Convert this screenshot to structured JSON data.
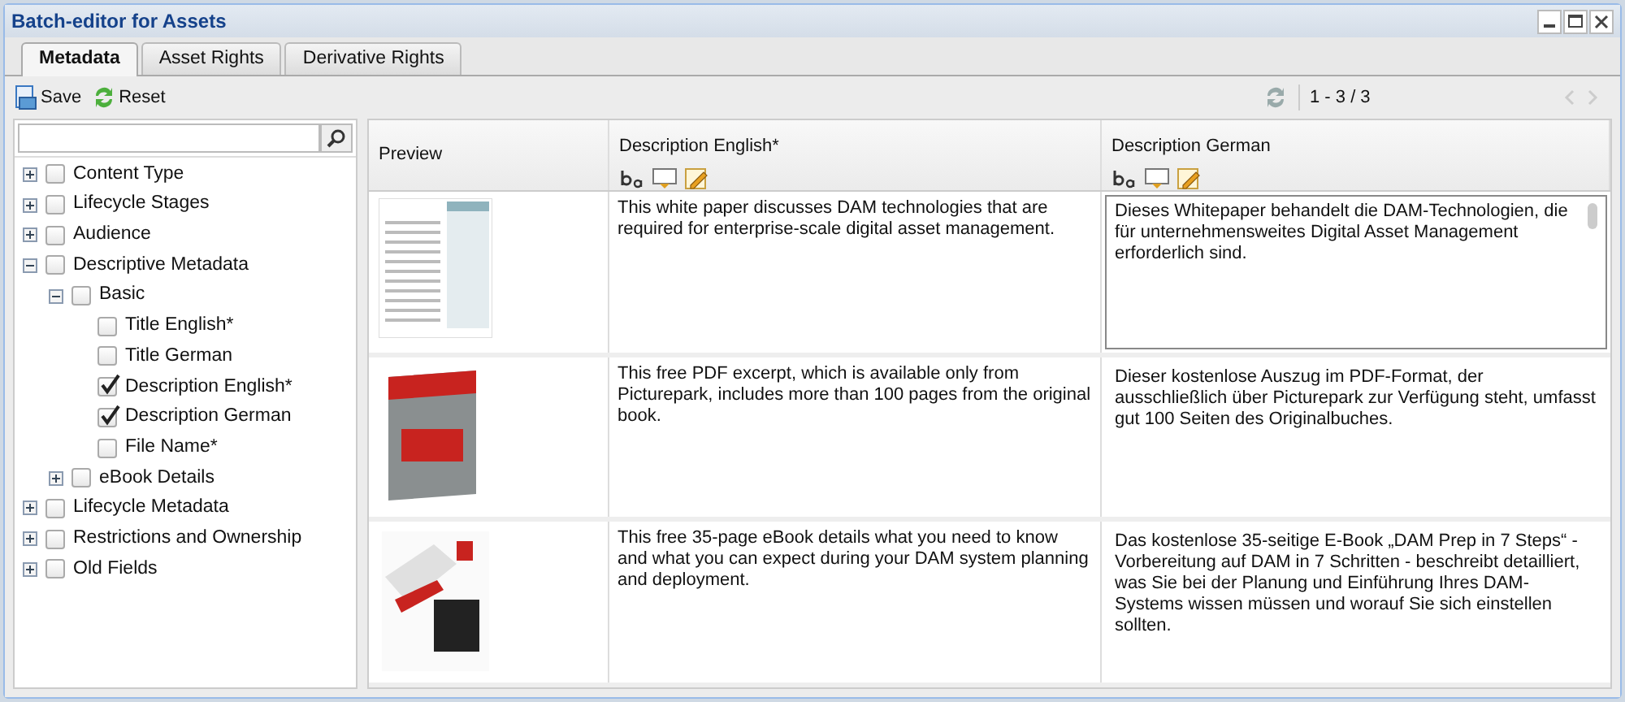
{
  "window": {
    "title": "Batch-editor for Assets"
  },
  "tabs": [
    {
      "label": "Metadata",
      "selected": true
    },
    {
      "label": "Asset Rights",
      "selected": false
    },
    {
      "label": "Derivative Rights",
      "selected": false
    }
  ],
  "toolbar": {
    "buttons": [
      {
        "kind": "save",
        "label": "Save"
      },
      {
        "kind": "reset",
        "label": "Reset"
      }
    ],
    "pager": "1 - 3 / 3"
  },
  "tree": [
    {
      "label": "Content Type",
      "expanded": false,
      "checked": false
    },
    {
      "label": "Lifecycle Stages",
      "expanded": false,
      "checked": false
    },
    {
      "label": "Audience",
      "expanded": false,
      "checked": false
    },
    {
      "label": "Descriptive Metadata",
      "expanded": true,
      "checked": false,
      "children": [
        {
          "label": "Basic",
          "expanded": true,
          "checked": false,
          "children": [
            {
              "label": "Title English*",
              "checked": false
            },
            {
              "label": "Title German",
              "checked": false
            },
            {
              "label": "Description English*",
              "checked": true
            },
            {
              "label": "Description German",
              "checked": true
            },
            {
              "label": "File Name*",
              "checked": false
            }
          ]
        },
        {
          "label": "eBook Details",
          "expanded": false,
          "checked": false
        }
      ]
    },
    {
      "label": "Lifecycle Metadata",
      "expanded": false,
      "checked": false
    },
    {
      "label": "Restrictions and Ownership",
      "expanded": false,
      "checked": false
    },
    {
      "label": "Old Fields",
      "expanded": false,
      "checked": false
    }
  ],
  "grid": {
    "columns": [
      "Preview",
      "Description English*",
      "Description German"
    ],
    "rows": [
      {
        "kind": "whitepaper",
        "english": "This white paper discusses DAM technologies that are required for enterprise-scale digital asset management.",
        "german": "Dieses Whitepaper behandelt die DAM-Technologien, die für unternehmensweites Digital Asset Management erforderlich sind.",
        "editing": true
      },
      {
        "kind": "book",
        "english": "This free PDF excerpt, which is available only from Picturepark, includes more than 100 pages from the original book.",
        "german": "Dieser kostenlose Auszug im PDF-Format, der ausschließlich über Picturepark zur Verfügung steht, umfasst gut 100 Seiten des Originalbuches.",
        "editing": false
      },
      {
        "kind": "ebook",
        "english": "This free 35-page eBook details what you need to know and what you can expect during your DAM system planning and deployment.",
        "german": "Das kostenlose 35-seitige E-Book „DAM Prep in 7 Steps“ - Vorbereitung auf DAM in 7 Schritten - beschreibt detailliert, was Sie bei der Planung und Einführung Ihres DAM-Systems wissen müssen und worauf Sie sich einstellen sollten.",
        "editing": false
      }
    ]
  }
}
